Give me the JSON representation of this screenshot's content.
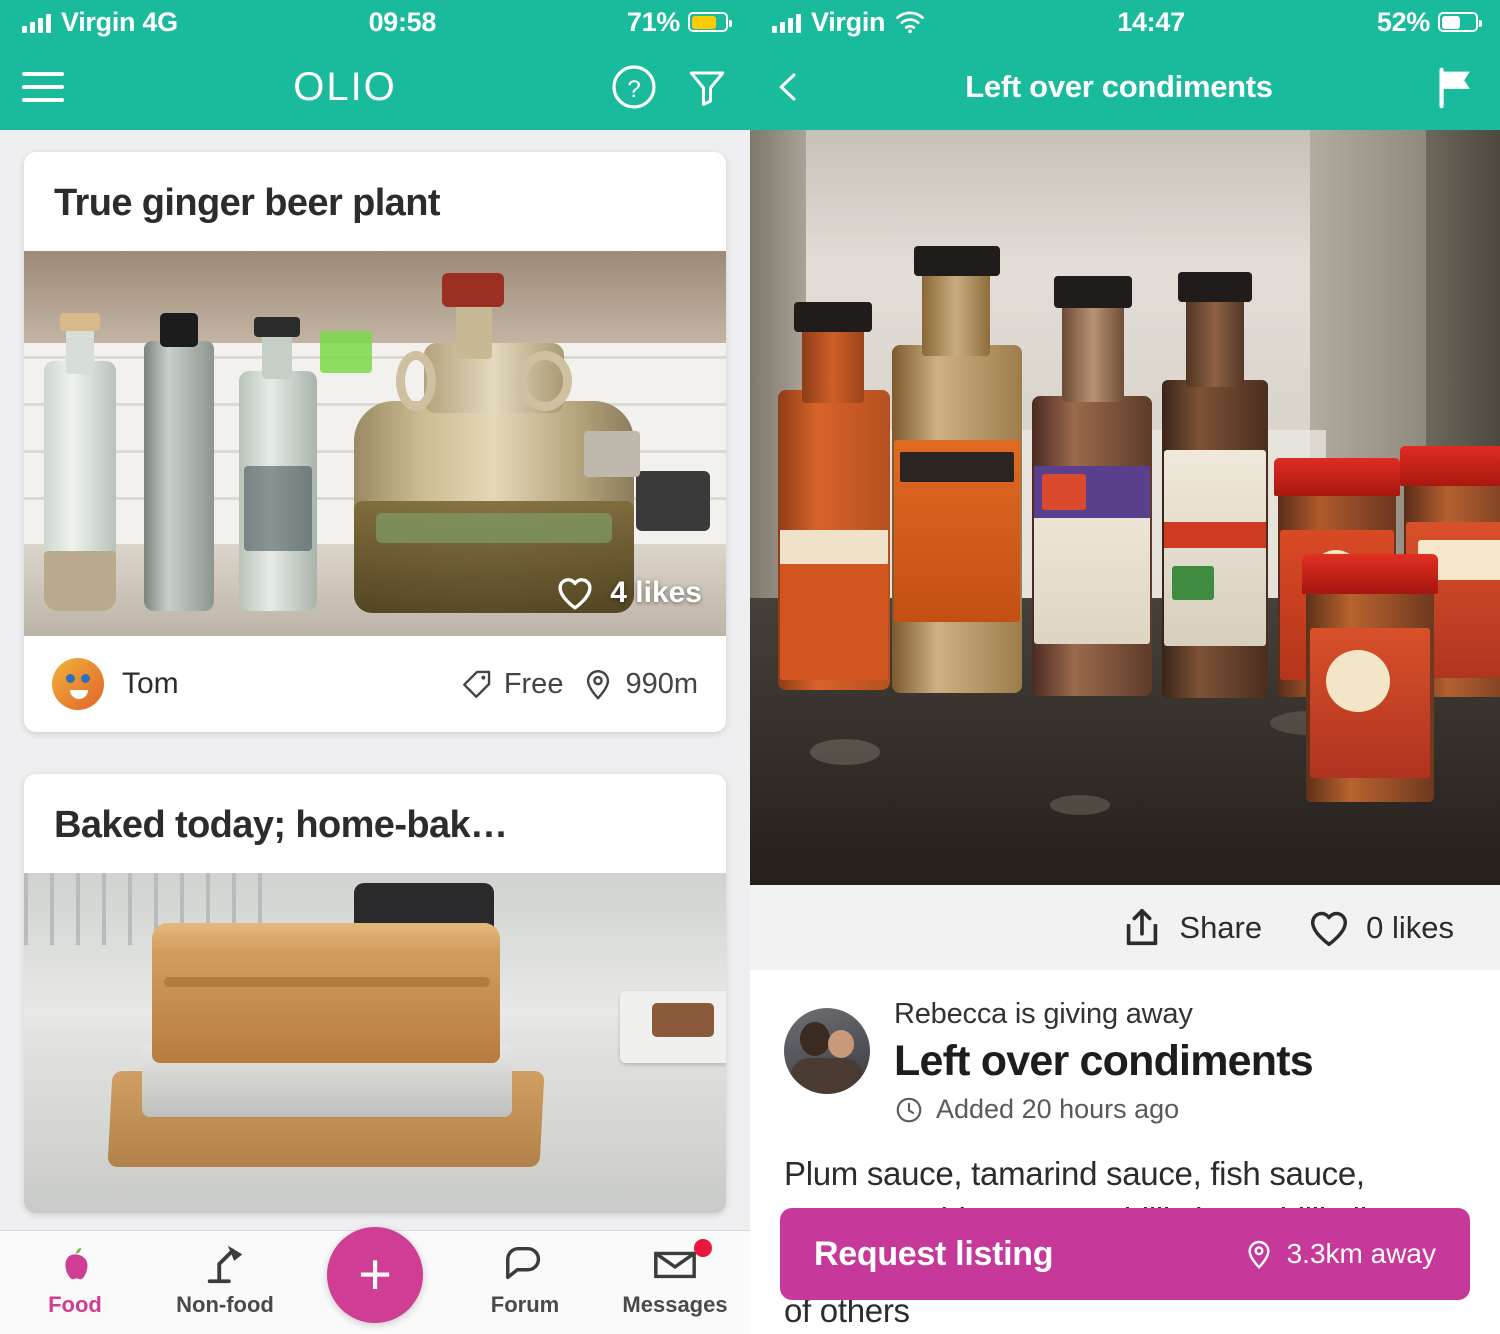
{
  "left": {
    "status_bar": {
      "carrier": "Virgin 4G",
      "time": "09:58",
      "battery_text": "71%",
      "battery_percent": 71,
      "battery_color": "#ffcc00",
      "signal_icon": "cellular-signal-icon"
    },
    "nav": {
      "menu_icon": "hamburger-menu-icon",
      "logo": "OLIO",
      "help_icon": "question-mark-circle-icon",
      "filter_icon": "filter-funnel-icon"
    },
    "feed": {
      "cards": [
        {
          "title": "True ginger beer plant",
          "likes": "4 likes",
          "like_icon": "heart-outline-icon",
          "author": "Tom",
          "avatar_icon": "user-avatar",
          "price": "Free",
          "price_icon": "price-tag-icon",
          "distance": "990m",
          "distance_icon": "location-pin-icon",
          "photo_icon": "listing-photo-ginger-beer-plant"
        },
        {
          "title": "Baked today; home-bak…",
          "photo_icon": "listing-photo-homemade-bread"
        }
      ]
    },
    "tabs": [
      {
        "label": "Food",
        "icon": "apple-icon",
        "active": true
      },
      {
        "label": "Non-food",
        "icon": "desk-lamp-icon",
        "active": false
      },
      {
        "label": "",
        "icon": "add-plus-icon",
        "active": false,
        "is_fab": true,
        "fab_symbol": "+"
      },
      {
        "label": "Forum",
        "icon": "speech-bubbles-icon",
        "active": false
      },
      {
        "label": "Messages",
        "icon": "envelope-icon",
        "active": false,
        "has_badge": true
      }
    ]
  },
  "right": {
    "status_bar": {
      "carrier": "Virgin",
      "wifi_icon": "wifi-icon",
      "time": "14:47",
      "battery_text": "52%",
      "battery_percent": 52,
      "battery_color": "#ffffff",
      "signal_icon": "cellular-signal-icon"
    },
    "nav": {
      "back_icon": "chevron-left-back-icon",
      "title": "Left over condiments",
      "flag_icon": "report-flag-icon"
    },
    "hero_photo_icon": "listing-photo-condiment-bottles",
    "actions": {
      "share_label": "Share",
      "share_icon": "share-export-icon",
      "likes_label": "0 likes",
      "like_icon": "heart-outline-icon"
    },
    "listing": {
      "avatar_icon": "user-avatar-rebecca",
      "giving_away": "Rebecca is giving away",
      "title": "Left over condiments",
      "added": "Added 20 hours ago",
      "clock_icon": "clock-icon",
      "description": "Plum sauce, tamarind sauce, fish sauce, worcestershire sauce, chilli chow chilli oil, laoganma preserved black bean sauce and lots of others"
    },
    "request": {
      "label": "Request listing",
      "distance": "3.3km away",
      "distance_icon": "location-pin-icon",
      "color": "#c6399a"
    }
  },
  "theme": {
    "teal": "#1aba9c",
    "magenta": "#cf3d94",
    "request_magenta": "#c6399a"
  }
}
